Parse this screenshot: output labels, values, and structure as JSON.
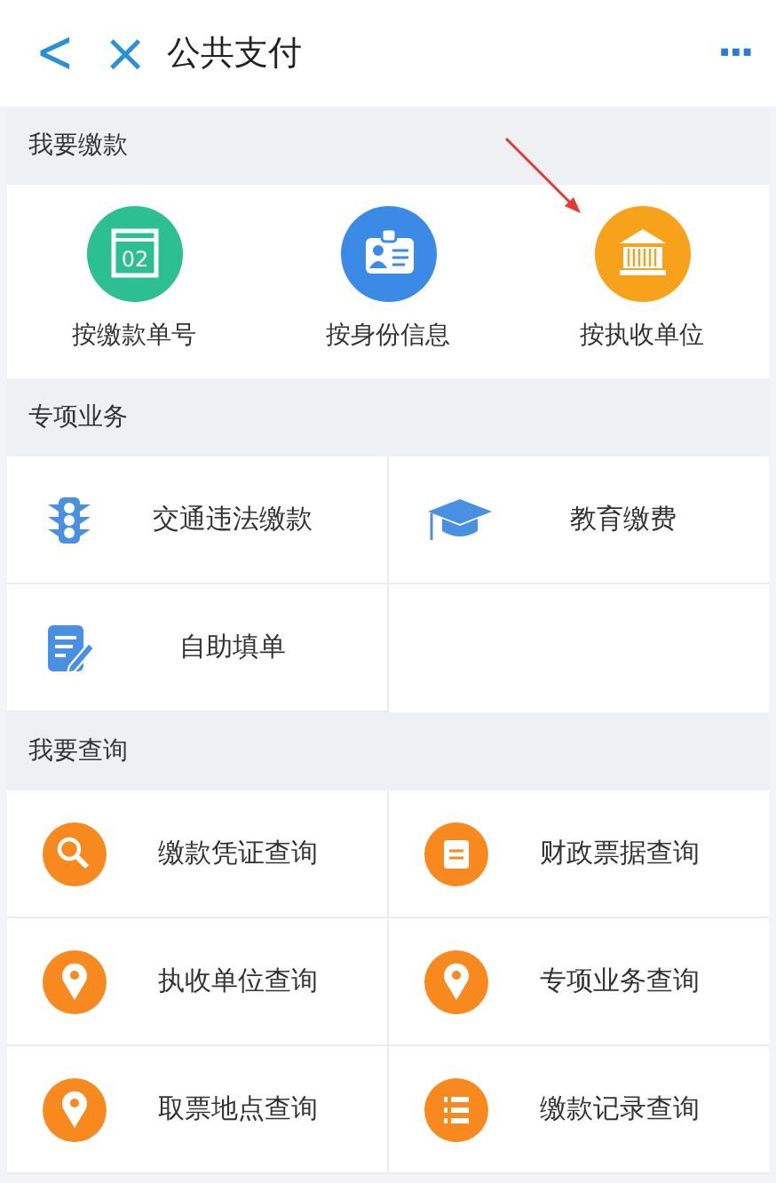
{
  "nav": {
    "back": "<",
    "close": "×",
    "title": "公共支付",
    "more": "···"
  },
  "sections": [
    {
      "title": "我要缴款",
      "kind": "circles",
      "items": [
        {
          "label": "按缴款单号",
          "icon_text": "02"
        },
        {
          "label": "按身份信息"
        },
        {
          "label": "按执收单位"
        }
      ]
    },
    {
      "title": "专项业务",
      "kind": "grid",
      "items": [
        {
          "label": "交通违法缴款"
        },
        {
          "label": "教育缴费"
        },
        {
          "label": "自助填单"
        }
      ]
    },
    {
      "title": "我要查询",
      "kind": "query",
      "items": [
        {
          "label": "缴款凭证查询"
        },
        {
          "label": "财政票据查询"
        },
        {
          "label": "执收单位查询"
        },
        {
          "label": "专项业务查询"
        },
        {
          "label": "取票地点查询"
        },
        {
          "label": "缴款记录查询"
        }
      ]
    }
  ]
}
